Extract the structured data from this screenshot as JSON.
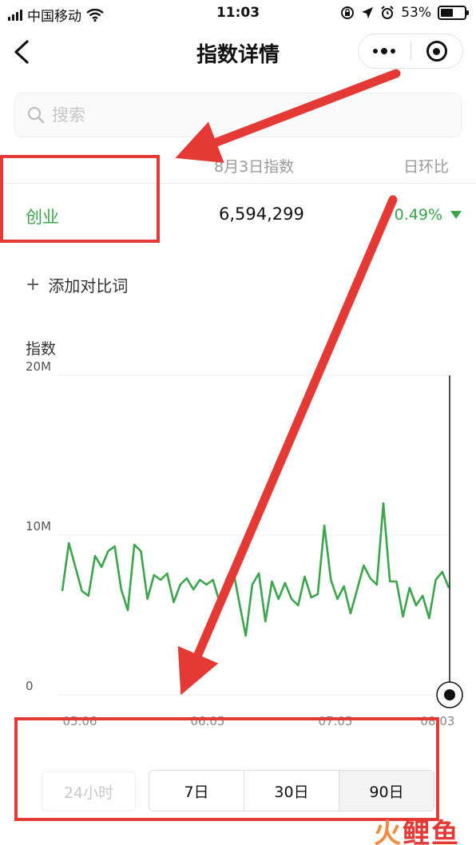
{
  "status_bar": {
    "carrier": "中国移动",
    "time": "11:03",
    "battery": "53%",
    "battery_fraction": 0.53
  },
  "nav": {
    "title": "指数详情",
    "back_icon": "chevron-left-icon",
    "more_icon": "more-dots-icon",
    "close_icon": "target-icon"
  },
  "search": {
    "placeholder": "搜索"
  },
  "table": {
    "date_header": "8月3日指数",
    "ratio_header": "日环比",
    "rows": [
      {
        "keyword": "创业",
        "value": "6,594,299",
        "change": "0.49%",
        "direction": "down"
      }
    ]
  },
  "add_compare": "添加对比词",
  "chart_data": {
    "type": "line",
    "ylabel": "指数",
    "ylim": [
      0,
      20000000
    ],
    "y_ticks": [
      "20M",
      "10M",
      "0"
    ],
    "x_ticks": [
      "05.06",
      "06.05",
      "07.05",
      "08.03"
    ],
    "grid": true,
    "color": "#3aa54a",
    "series": [
      {
        "values": [
          6.5,
          9.5,
          8.0,
          6.5,
          6.2,
          8.7,
          8.0,
          9.0,
          9.3,
          6.6,
          5.3,
          9.4,
          9.0,
          6.0,
          7.5,
          7.2,
          7.6,
          5.8,
          6.9,
          7.3,
          6.6,
          7.2,
          6.9,
          7.2,
          5.8,
          7.2,
          8.0,
          5.8,
          3.7,
          6.9,
          7.6,
          4.6,
          7.1,
          6.0,
          7.0,
          6.0,
          5.6,
          7.4,
          6.1,
          6.3,
          10.6,
          7.2,
          6.0,
          6.8,
          5.1,
          6.6,
          8.1,
          7.3,
          6.9,
          12.0,
          7.1,
          7.1,
          4.9,
          6.7,
          5.6,
          6.2,
          4.8,
          7.2,
          7.7,
          6.7
        ]
      }
    ],
    "series_units": "million"
  },
  "time_range": {
    "options": [
      "24小时",
      "7日",
      "30日",
      "90日"
    ],
    "selected": "90日"
  },
  "annotation_color": "#e53935",
  "logo_text": [
    "火",
    "鲤",
    "鱼"
  ]
}
